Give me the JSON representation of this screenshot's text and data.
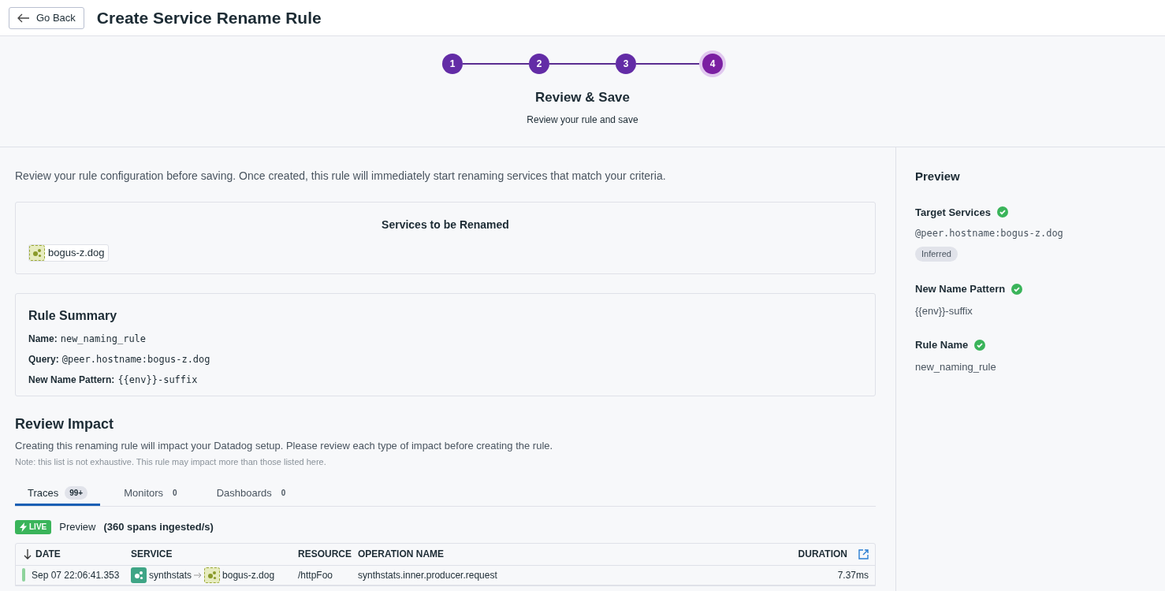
{
  "header": {
    "back_button": "Go Back",
    "title": "Create Service Rename Rule"
  },
  "stepper": {
    "steps": [
      {
        "label": "1",
        "selected": false
      },
      {
        "label": "2",
        "selected": false
      },
      {
        "label": "3",
        "selected": false
      },
      {
        "label": "4",
        "selected": true
      }
    ],
    "title": "Review & Save",
    "subtitle": "Review your rule and save"
  },
  "intro": "Review your rule configuration before saving. Once created, this rule will immediately start renaming services that match your criteria.",
  "services_card": {
    "title": "Services to be Renamed",
    "services": [
      "bogus-z.dog"
    ]
  },
  "rule_summary": {
    "title": "Rule Summary",
    "fields": [
      {
        "label": "Name:",
        "value": "new_naming_rule"
      },
      {
        "label": "Query:",
        "value": "@peer.hostname:bogus-z.dog"
      },
      {
        "label": "New Name Pattern:",
        "value": "{{env}}-suffix"
      }
    ]
  },
  "review_impact": {
    "title": "Review Impact",
    "description": "Creating this renaming rule will impact your Datadog setup. Please review each type of impact before creating the rule.",
    "note": "Note: this list is not exhaustive. This rule may impact more than those listed here.",
    "tabs": [
      {
        "label": "Traces",
        "count": "99+",
        "selected": true
      },
      {
        "label": "Monitors",
        "count": "0",
        "selected": false
      },
      {
        "label": "Dashboards",
        "count": "0",
        "selected": false
      }
    ],
    "live_badge": "LIVE",
    "preview_label": "Preview",
    "rate": "(360 spans ingested/s)",
    "table": {
      "columns": [
        "DATE",
        "SERVICE",
        "RESOURCE",
        "OPERATION NAME",
        "DURATION"
      ],
      "rows": [
        {
          "date": "Sep 07 22:06:41.353",
          "service_from": "synthstats",
          "service_to": "bogus-z.dog",
          "resource": "/httpFoo",
          "operation": "synthstats.inner.producer.request",
          "duration": "7.37ms"
        }
      ]
    }
  },
  "preview_panel": {
    "title": "Preview",
    "sections": [
      {
        "label": "Target Services",
        "valid": true,
        "value": "@peer.hostname:bogus-z.dog",
        "kind": "mono",
        "tag": "Inferred"
      },
      {
        "label": "New Name Pattern",
        "valid": true,
        "value": "{{env}}-suffix",
        "kind": "plain"
      },
      {
        "label": "Rule Name",
        "valid": true,
        "value": "new_naming_rule",
        "kind": "plain"
      }
    ]
  }
}
